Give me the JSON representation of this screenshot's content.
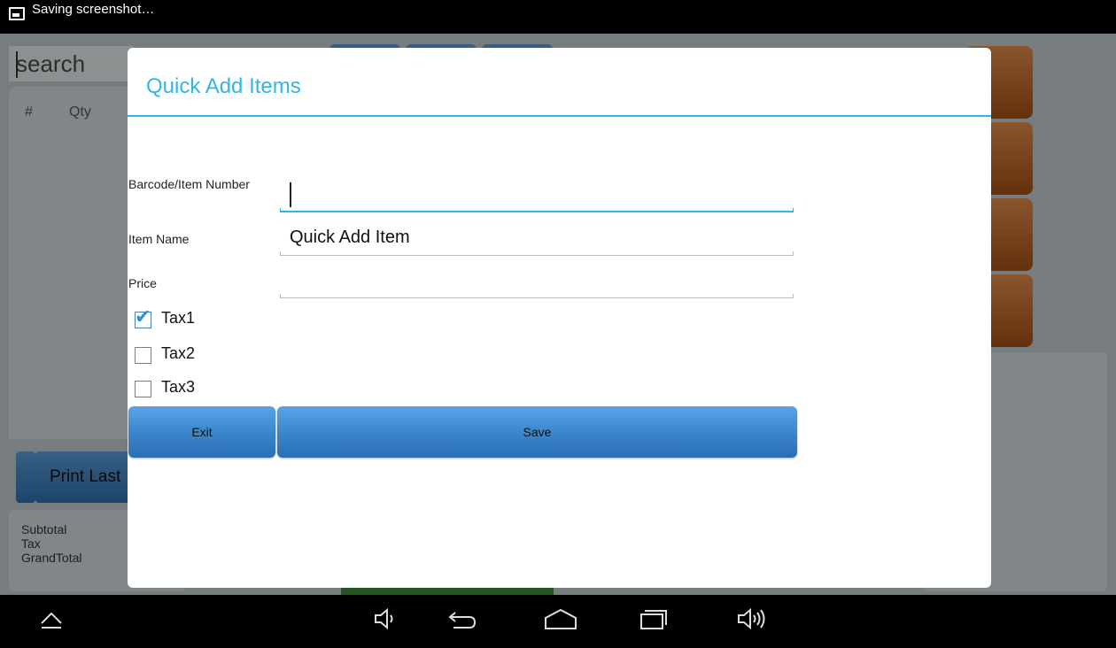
{
  "status_bar": {
    "notification_text": "Saving screenshot…",
    "notification_icon": "image-icon"
  },
  "background_app": {
    "search_placeholder": "search",
    "order_columns": [
      "#",
      "Qty"
    ],
    "print_button_label": "Print Last",
    "totals": {
      "subtotal_label": "Subtotal",
      "tax_label": "Tax",
      "grandtotal_label": "GrandTotal"
    }
  },
  "dialog": {
    "title": "Quick Add Items",
    "fields": {
      "barcode": {
        "label": "Barcode/Item Number",
        "value": ""
      },
      "item_name": {
        "label": "Item Name",
        "value": "Quick Add Item"
      },
      "price": {
        "label": "Price",
        "value": ""
      }
    },
    "taxes": [
      {
        "label": "Tax1",
        "checked": true
      },
      {
        "label": "Tax2",
        "checked": false
      },
      {
        "label": "Tax3",
        "checked": false
      }
    ],
    "buttons": {
      "exit_label": "Exit",
      "save_label": "Save"
    }
  },
  "nav_bar": {
    "icons": [
      "up-arrow-icon",
      "volume-down-icon",
      "back-icon",
      "home-icon",
      "recent-apps-icon",
      "volume-up-icon"
    ]
  },
  "colors": {
    "accent": "#33b5e5",
    "button_blue": "#3a84cb",
    "dialog_bg": "#ffffff"
  }
}
